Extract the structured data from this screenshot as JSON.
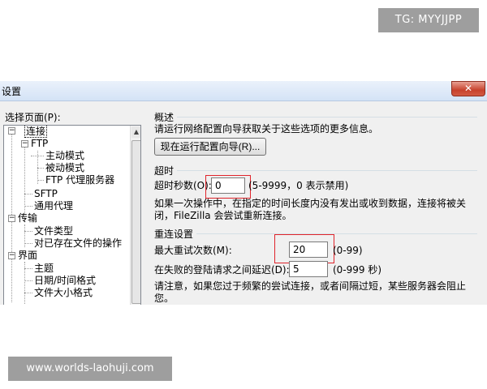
{
  "watermarks": {
    "top": "TG: MYYJJPP",
    "bottom": "www.worlds-laohuji.com"
  },
  "window": {
    "title": "设置",
    "close_glyph": "✕"
  },
  "sidebar": {
    "label": "选择页面(P):",
    "tree": [
      {
        "id": "connection",
        "label": "连接",
        "selected": true,
        "expanded": true
      },
      {
        "id": "ftp",
        "label": "FTP",
        "expanded": true
      },
      {
        "id": "active-mode",
        "label": "主动模式"
      },
      {
        "id": "passive-mode",
        "label": "被动模式"
      },
      {
        "id": "ftp-proxy",
        "label": "FTP 代理服务器"
      },
      {
        "id": "sftp",
        "label": "SFTP"
      },
      {
        "id": "generic-proxy",
        "label": "通用代理"
      },
      {
        "id": "transfers",
        "label": "传输",
        "expanded": true
      },
      {
        "id": "file-types",
        "label": "文件类型"
      },
      {
        "id": "file-exists",
        "label": "对已存在文件的操作"
      },
      {
        "id": "interface",
        "label": "界面",
        "expanded": true
      },
      {
        "id": "themes",
        "label": "主题"
      },
      {
        "id": "datetime-format",
        "label": "日期/时间格式"
      },
      {
        "id": "filesize-format",
        "label": "文件大小格式"
      }
    ]
  },
  "overview": {
    "heading": "概述",
    "description": "请运行网络配置向导获取关于这些选项的更多信息。",
    "wizard_button": "现在运行配置向导(R)..."
  },
  "timeout": {
    "heading": "超时",
    "label": "超时秒数(O):",
    "value": "0",
    "hint": "(5-9999，0 表示禁用)",
    "description": "如果一次操作中，在指定的时间长度内没有发出或收到数据，连接将被关闭，FileZilla 会尝试重新连接。"
  },
  "reconnect": {
    "heading": "重连设置",
    "max_retries_label": "最大重试次数(M):",
    "max_retries_value": "20",
    "max_retries_hint": "(0-99)",
    "delay_label": "在失败的登陆请求之间延迟(D):",
    "delay_value": "5",
    "delay_hint": "(0-999 秒)",
    "note": "请注意，如果您过于频繁的尝试连接，或者间隔过短，某些服务器会阻止您。"
  },
  "colors": {
    "highlight_box": "#e0242b",
    "watermark_bg": "#9e9e9e"
  }
}
